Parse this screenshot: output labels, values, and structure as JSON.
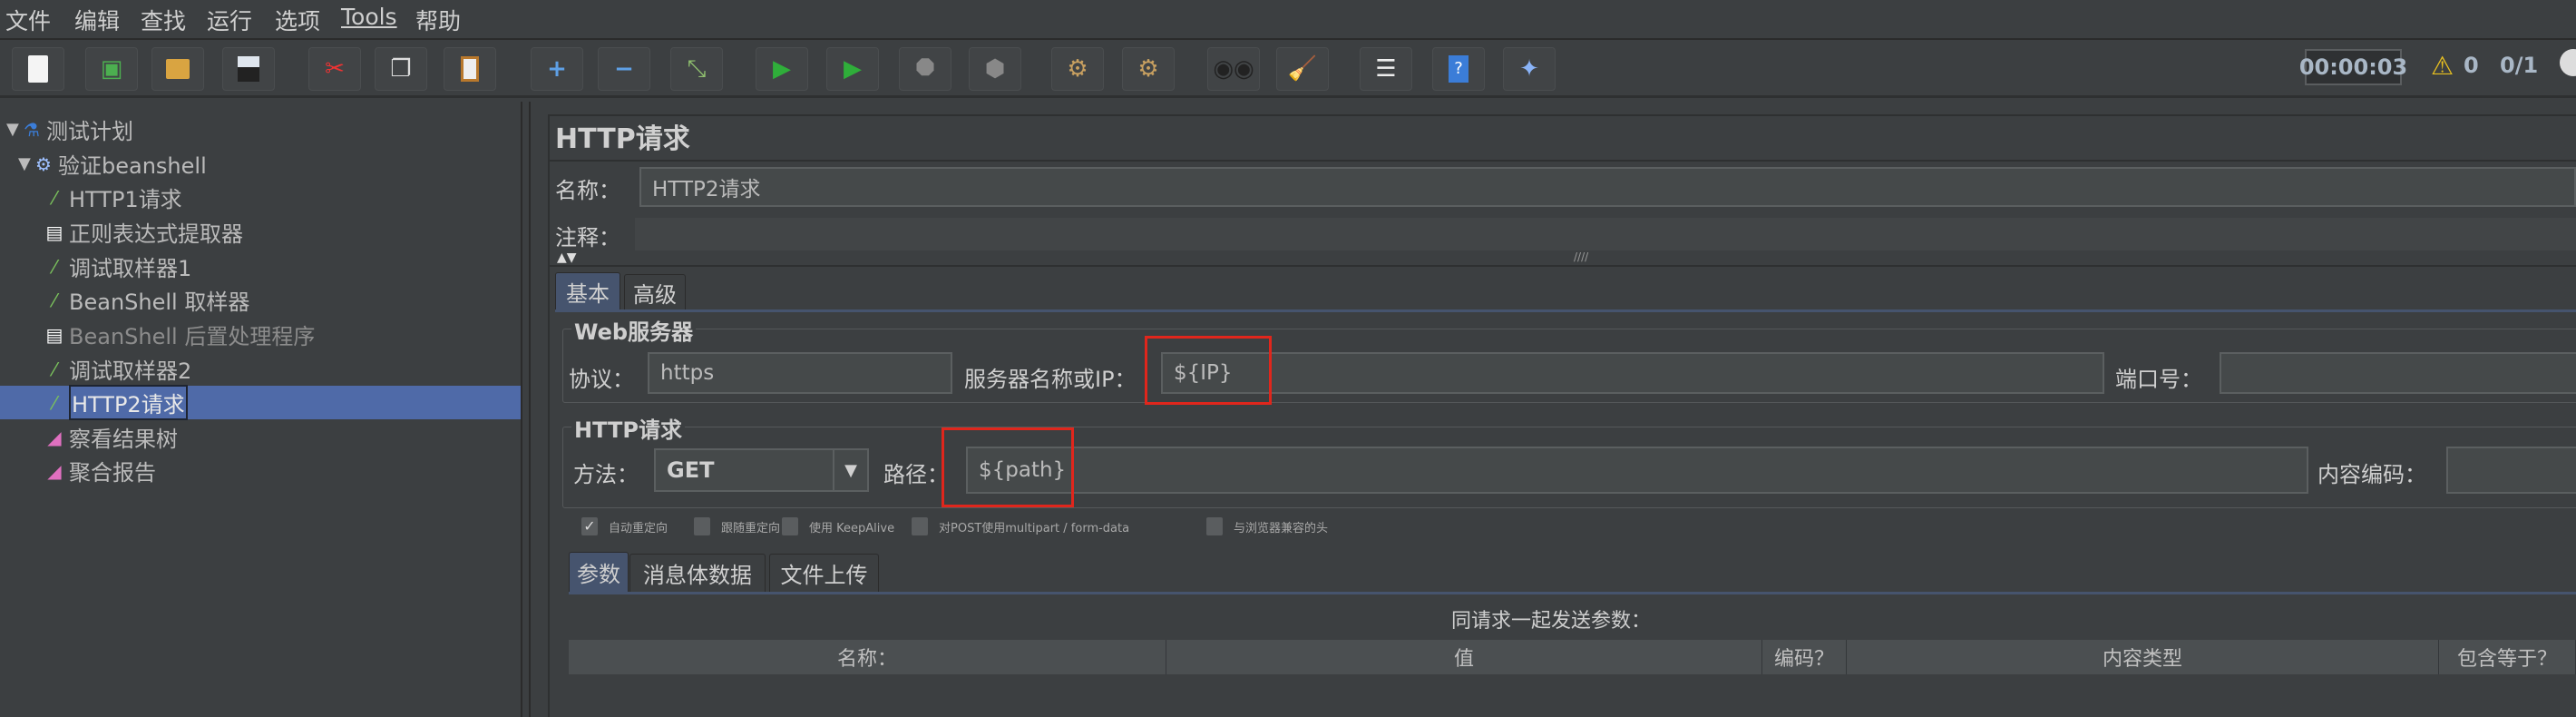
{
  "menu": [
    "文件",
    "编辑",
    "查找",
    "运行",
    "选项",
    "Tools",
    "帮助"
  ],
  "toolbar": {
    "buttons": [
      "new",
      "templates",
      "open",
      "save",
      "cut",
      "copy",
      "paste",
      "expand",
      "collapse",
      "toggle",
      "start",
      "start-no-pause",
      "stop",
      "shutdown",
      "clear",
      "clear-all",
      "search",
      "reset-search",
      "function-helper",
      "help",
      "remote"
    ],
    "timer": "00:00:03",
    "warnings": "0",
    "threads": "0/1"
  },
  "tree": [
    {
      "label": "测试计划",
      "icon": "flask-icon",
      "level": 0,
      "expanded": true
    },
    {
      "label": "验证beanshell",
      "icon": "gear-icon",
      "level": 1,
      "expanded": true
    },
    {
      "label": "HTTP1请求",
      "icon": "pipette-icon",
      "level": 2
    },
    {
      "label": "正则表达式提取器",
      "icon": "document-arrow-icon",
      "level": 2
    },
    {
      "label": "调试取样器1",
      "icon": "pipette-icon",
      "level": 2
    },
    {
      "label": "BeanShell 取样器",
      "icon": "pipette-icon",
      "level": 2
    },
    {
      "label": "BeanShell 后置处理程序",
      "icon": "document-arrow-icon",
      "level": 2,
      "disabled": true
    },
    {
      "label": "调试取样器2",
      "icon": "pipette-icon",
      "level": 2
    },
    {
      "label": "HTTP2请求",
      "icon": "pipette-icon",
      "level": 2,
      "selected": true
    },
    {
      "label": "察看结果树",
      "icon": "chart-icon",
      "level": 2
    },
    {
      "label": "聚合报告",
      "icon": "chart-icon",
      "level": 2
    }
  ],
  "panel": {
    "title": "HTTP请求",
    "name_label": "名称：",
    "name_value": "HTTP2请求",
    "comment_label": "注释：",
    "comment_value": "",
    "tabs": [
      "基本",
      "高级"
    ],
    "web_server": {
      "title": "Web服务器",
      "protocol_label": "协议：",
      "protocol_value": "https",
      "server_label": "服务器名称或IP：",
      "server_value": "${IP}",
      "port_label": "端口号：",
      "port_value": ""
    },
    "http_request": {
      "title": "HTTP请求",
      "method_label": "方法：",
      "method_value": "GET",
      "path_label": "路径：",
      "path_value": "${path}",
      "encoding_label": "内容编码：",
      "encoding_value": ""
    },
    "checkboxes": [
      {
        "label": "自动重定向",
        "checked": true
      },
      {
        "label": "跟随重定向",
        "checked": false
      },
      {
        "label": "使用 KeepAlive",
        "checked": false
      },
      {
        "label": "对POST使用multipart / form-data",
        "checked": false
      },
      {
        "label": "与浏览器兼容的头",
        "checked": false
      }
    ],
    "sub_tabs": [
      "参数",
      "消息体数据",
      "文件上传"
    ],
    "params_caption": "同请求一起发送参数：",
    "columns": [
      "名称：",
      "值",
      "编码？",
      "内容类型",
      "包含等于？"
    ]
  },
  "colors": {
    "selection": "#4f6aa8",
    "highlight_box": "#e0261c",
    "background": "#3c3f41"
  }
}
